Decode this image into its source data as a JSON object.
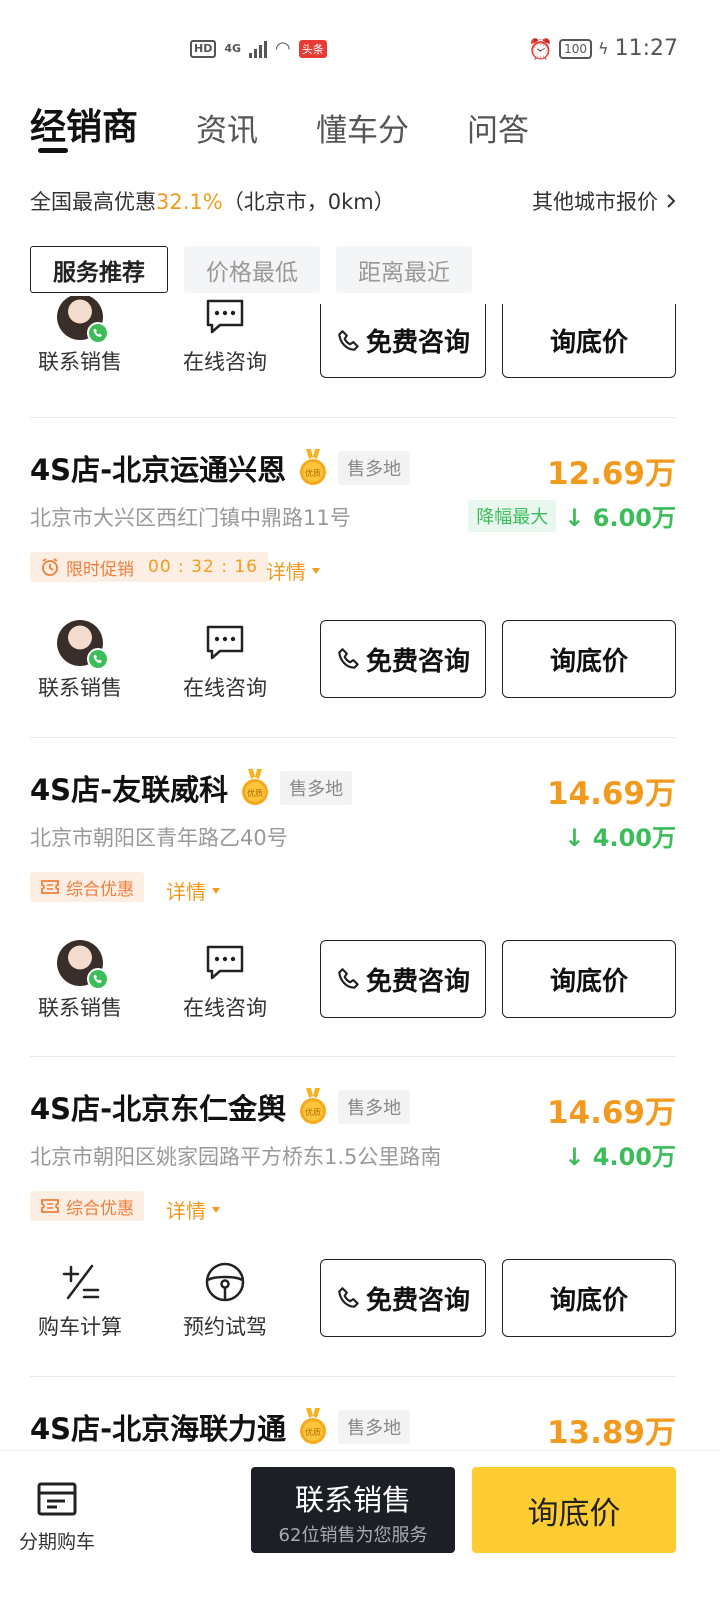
{
  "status_bar": {
    "hd": "HD",
    "network": "4G",
    "news_badge": "头条",
    "battery": "100",
    "time": "11:27"
  },
  "tabs": [
    {
      "label": "经销商",
      "active": true
    },
    {
      "label": "资讯",
      "active": false
    },
    {
      "label": "懂车分",
      "active": false
    },
    {
      "label": "问答",
      "active": false
    }
  ],
  "promo": {
    "prefix": "全国最高优惠",
    "percent": "32.1%",
    "suffix": "（北京市，0km）",
    "other_city": "其他城市报价"
  },
  "filters": [
    {
      "label": "服务推荐",
      "active": true
    },
    {
      "label": "价格最低",
      "active": false
    },
    {
      "label": "距离最近",
      "active": false
    }
  ],
  "actions": {
    "contact_sales": "联系销售",
    "online_consult": "在线咨询",
    "free_consult": "免费咨询",
    "ask_price": "询底价",
    "calc": "购车计算",
    "test_drive": "预约试驾"
  },
  "quality_badge": "优质",
  "dealers": [
    {
      "name": "4S店-北京运通兴恩",
      "tag": "售多地",
      "price": "12.69万",
      "address": "北京市大兴区西红门镇中鼎路11号",
      "drop_badge": "降幅最大",
      "drop": "6.00万",
      "promo_label": "限时促销",
      "promo_timer": "00 : 32 : 16",
      "detail": "详情"
    },
    {
      "name": "4S店-友联威科",
      "tag": "售多地",
      "price": "14.69万",
      "address": "北京市朝阳区青年路乙40号",
      "drop": "4.00万",
      "promo_label": "综合优惠",
      "detail": "详情"
    },
    {
      "name": "4S店-北京东仁金舆",
      "tag": "售多地",
      "price": "14.69万",
      "address": "北京市朝阳区姚家园路平方桥东1.5公里路南",
      "drop": "4.00万",
      "promo_label": "综合优惠",
      "detail": "详情"
    },
    {
      "name": "4S店-北京海联力通",
      "tag": "售多地",
      "price": "13.89万"
    }
  ],
  "bottom": {
    "installment": "分期购车",
    "contact_title": "联系销售",
    "contact_sub": "62位销售为您服务",
    "ask_price": "询底价"
  }
}
